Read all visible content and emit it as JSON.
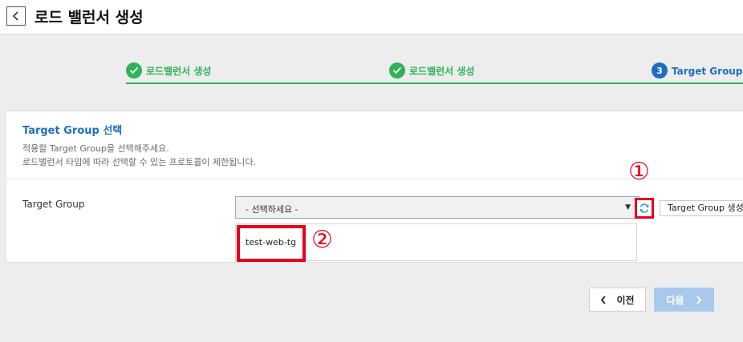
{
  "header": {
    "back_icon": "chevron-left-icon",
    "title": "로드 밸런서 생성"
  },
  "steps": [
    {
      "label": "로드밸런서 생성",
      "status": "done",
      "marker_icon": "check-icon"
    },
    {
      "label": "로드밸런서 생성",
      "status": "done",
      "marker_icon": "check-icon"
    },
    {
      "label": "Target Group 선택",
      "status": "active",
      "marker": "3"
    }
  ],
  "section": {
    "title": "Target Group 선택",
    "desc_line1": "적용할 Target Group을 선택해주세요.",
    "desc_line2": "로드밸런서 타입에 따라 선택할 수 있는 프로토콜이 제한됩니다."
  },
  "form": {
    "label": "Target Group",
    "select_value": "- 선택하세요 -",
    "options": [
      "test-web-tg"
    ],
    "refresh_icon": "refresh-icon",
    "create_button": "Target Group 생성"
  },
  "annotations": {
    "one": "①",
    "two": "②"
  },
  "footer": {
    "prev_label": "이전",
    "next_label": "다음"
  },
  "colors": {
    "step_done": "#2fb35a",
    "step_active": "#1e6fc2",
    "annotation_red": "#e5001c",
    "next_disabled": "#a9c9ec"
  }
}
